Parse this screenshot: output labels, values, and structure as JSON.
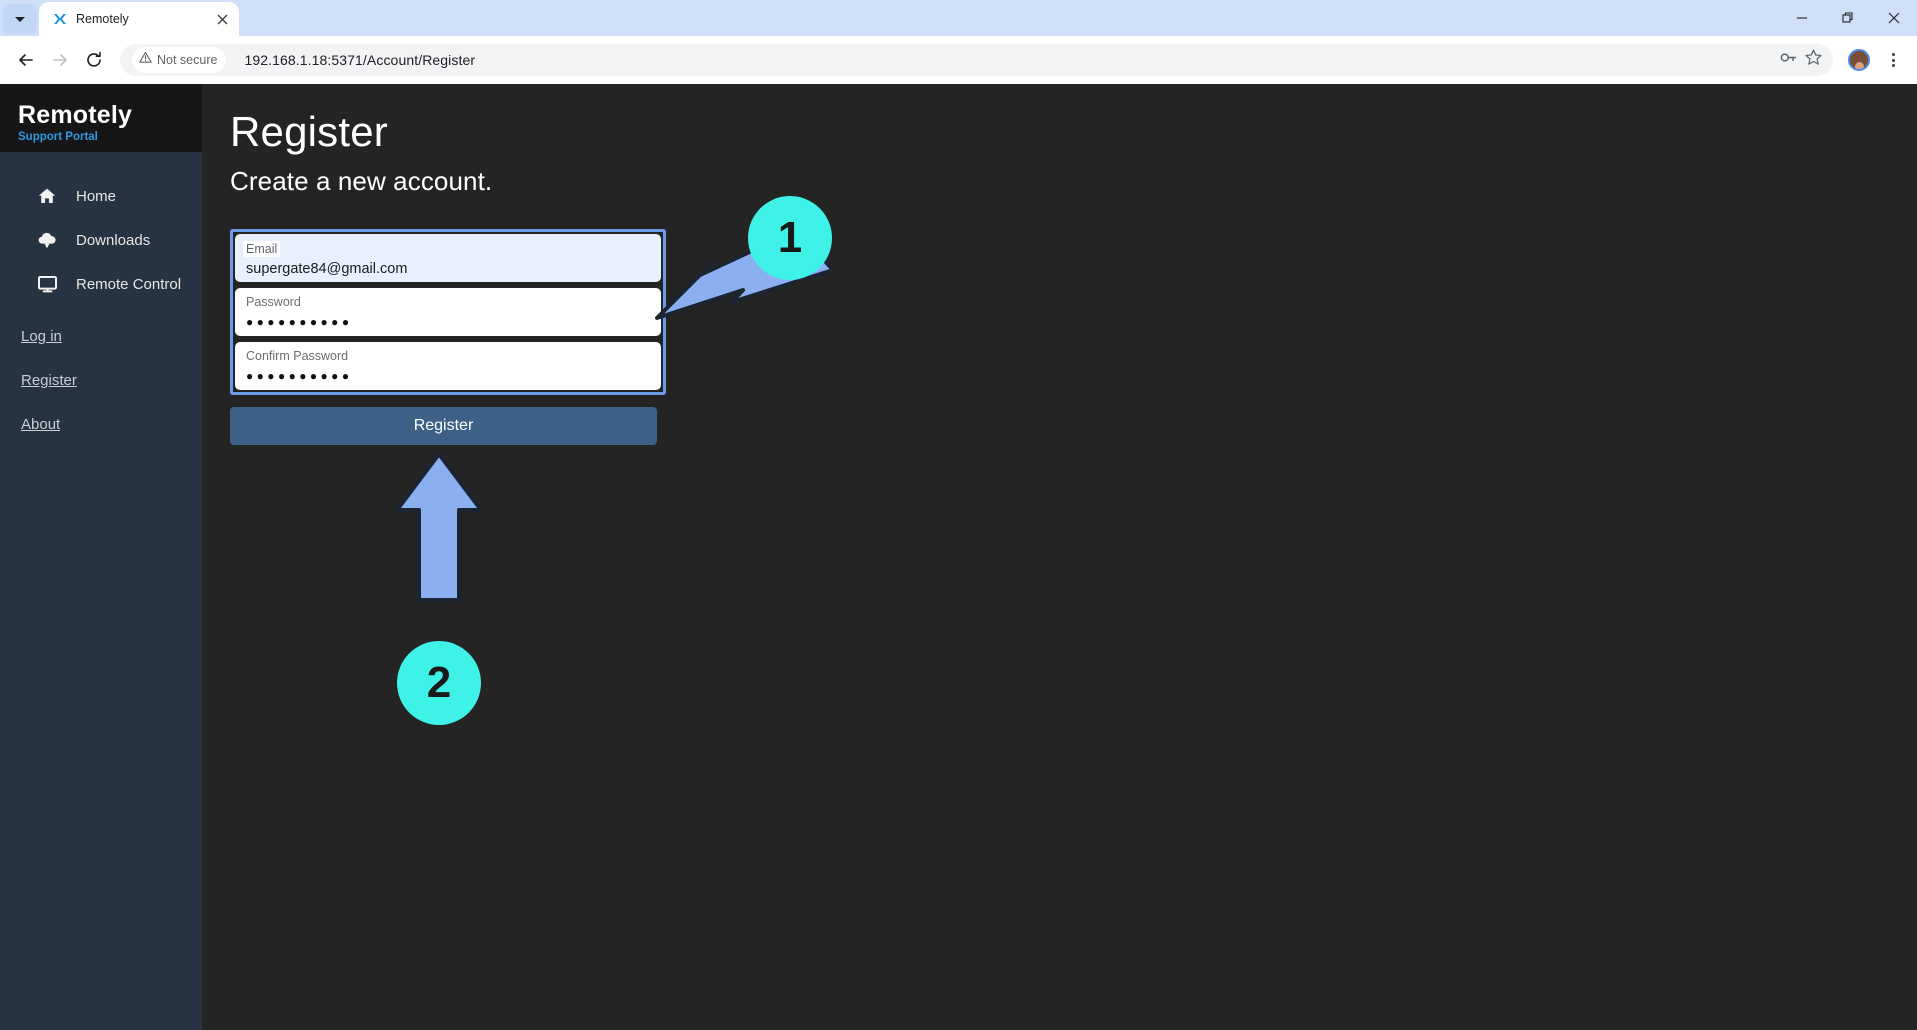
{
  "browser": {
    "tab_list_icon": "chevron-down-icon",
    "tab": {
      "favicon": "remotely-favicon",
      "title": "Remotely",
      "close_icon": "close-icon"
    },
    "window_controls": {
      "minimize": "minimize-icon",
      "maximize": "restore-icon",
      "close": "close-icon"
    },
    "toolbar": {
      "back_icon": "back-arrow-icon",
      "forward_icon": "forward-arrow-icon",
      "reload_icon": "reload-icon",
      "security_label": "Not secure",
      "security_icon": "warning-triangle-icon",
      "url": "192.168.1.18:5371/Account/Register",
      "password_manager_icon": "key-icon",
      "bookmark_icon": "star-icon",
      "profile_icon": "profile-avatar",
      "menu_icon": "kebab-menu-icon"
    }
  },
  "sidebar": {
    "brand": "Remotely",
    "subtitle": "Support Portal",
    "items": [
      {
        "label": "Home",
        "icon": "home-icon"
      },
      {
        "label": "Downloads",
        "icon": "cloud-download-icon"
      },
      {
        "label": "Remote Control",
        "icon": "monitor-icon"
      }
    ],
    "links": [
      {
        "label": "Log in"
      },
      {
        "label": "Register"
      },
      {
        "label": "About"
      }
    ]
  },
  "main": {
    "title": "Register",
    "subtitle": "Create a new account.",
    "fields": [
      {
        "label": "Email",
        "value": "supergate84@gmail.com",
        "type": "email",
        "autofilled": true
      },
      {
        "label": "Password",
        "value": "●●●●●●●●●●",
        "type": "password",
        "autofilled": false
      },
      {
        "label": "Confirm Password",
        "value": "●●●●●●●●●●",
        "type": "password",
        "autofilled": false
      }
    ],
    "submit_label": "Register"
  },
  "annotations": {
    "badge1": "1",
    "badge2": "2",
    "arrow_color": "#8bb0f2",
    "badge_color": "#3ef2e8"
  },
  "colors": {
    "sidebar_bg": "#263340",
    "sidebar_header_bg": "#161616",
    "content_bg": "#242424",
    "accent_link": "#2f9ae0",
    "button_bg": "#3d6186",
    "focus_ring": "#6a9ceb",
    "autofill_bg": "#e8f0fe"
  }
}
